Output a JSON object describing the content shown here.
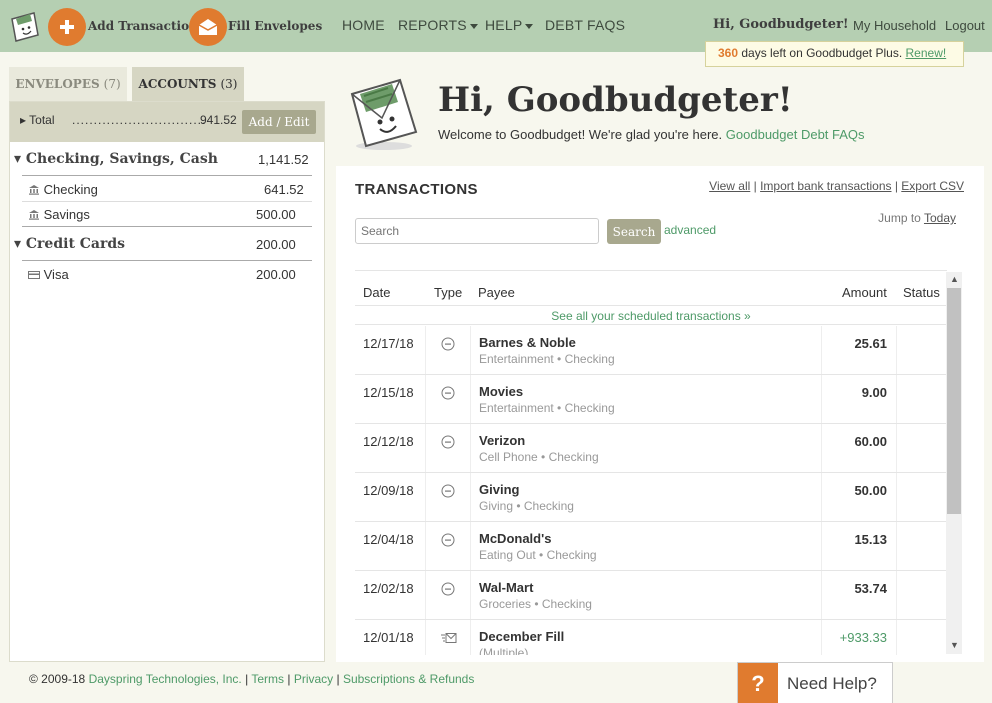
{
  "topbar": {
    "add_transaction": "Add Transaction",
    "fill_envelopes": "Fill Envelopes",
    "nav": {
      "home": "HOME",
      "reports": "REPORTS",
      "help": "HELP",
      "debt_faqs": "DEBT FAQS"
    },
    "greeting": "Hi, Goodbudgeter!",
    "my_household": "My Household",
    "logout": "Logout",
    "plus_days": "360",
    "plus_text": "days left on Goodbudget Plus.",
    "renew": "Renew!"
  },
  "sidebar": {
    "tab_envelopes": "ENVELOPES",
    "tab_envelopes_count": "(7)",
    "tab_accounts": "ACCOUNTS",
    "tab_accounts_count": "(3)",
    "total_label": "Total",
    "total_dots": "...............................",
    "total_amount": "941.52",
    "add_edit": "Add / Edit",
    "groups": [
      {
        "name": "Checking, Savings, Cash",
        "amount": "1,141.52",
        "accounts": [
          {
            "name": "Checking",
            "amount": "641.52"
          },
          {
            "name": "Savings",
            "amount": "500.00"
          }
        ]
      },
      {
        "name": "Credit Cards",
        "amount": "200.00",
        "accounts": [
          {
            "name": "Visa",
            "amount": "200.00"
          }
        ]
      }
    ]
  },
  "welcome": {
    "title": "Hi, Goodbudgeter!",
    "text": "Welcome to Goodbudget! We're glad you're here.",
    "link": "Goodbudget Debt FAQs"
  },
  "transactions": {
    "title": "TRANSACTIONS",
    "view_all": "View all",
    "import": "Import bank transactions",
    "export": "Export CSV",
    "search_placeholder": "Search",
    "search_button": "Search",
    "advanced": "advanced",
    "jump_to": "Jump to",
    "today": "Today",
    "headers": {
      "date": "Date",
      "type": "Type",
      "payee": "Payee",
      "amount": "Amount",
      "status": "Status"
    },
    "scheduled": "See all your scheduled transactions »",
    "rows": [
      {
        "date": "12/17/18",
        "payee": "Barnes & Noble",
        "envelope": "Entertainment",
        "account": "Checking",
        "amount": "25.61",
        "type": "expense"
      },
      {
        "date": "12/15/18",
        "payee": "Movies",
        "envelope": "Entertainment",
        "account": "Checking",
        "amount": "9.00",
        "type": "expense"
      },
      {
        "date": "12/12/18",
        "payee": "Verizon",
        "envelope": "Cell Phone",
        "account": "Checking",
        "amount": "60.00",
        "type": "expense"
      },
      {
        "date": "12/09/18",
        "payee": "Giving",
        "envelope": "Giving",
        "account": "Checking",
        "amount": "50.00",
        "type": "expense"
      },
      {
        "date": "12/04/18",
        "payee": "McDonald's",
        "envelope": "Eating Out",
        "account": "Checking",
        "amount": "15.13",
        "type": "expense"
      },
      {
        "date": "12/02/18",
        "payee": "Wal-Mart",
        "envelope": "Groceries",
        "account": "Checking",
        "amount": "53.74",
        "type": "expense"
      },
      {
        "date": "12/01/18",
        "payee": "December Fill",
        "envelope": "(Multiple)",
        "account": "",
        "amount": "+933.33",
        "type": "fill"
      }
    ]
  },
  "footer": {
    "copyright": "© 2009-18",
    "company": "Dayspring Technologies, Inc.",
    "terms": "Terms",
    "privacy": "Privacy",
    "subscriptions": "Subscriptions & Refunds"
  },
  "help": {
    "q": "?",
    "label": "Need Help?"
  },
  "colors": {
    "accent": "#e07b2f",
    "topbar": "#b5cfb2",
    "link": "#4e9a68"
  }
}
